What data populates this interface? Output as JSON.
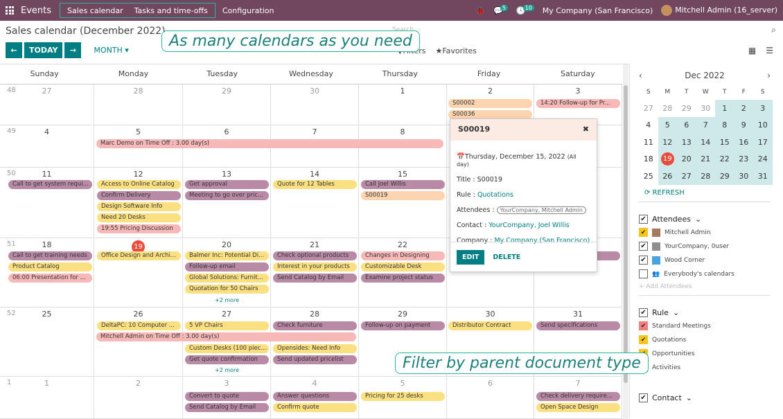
{
  "topbar": {
    "app_name": "Events",
    "nav": [
      "Sales calendar",
      "Tasks and time-offs"
    ],
    "config": "Configuration",
    "msg_count": "5",
    "activity_count": "10",
    "company": "My Company (San Francisco)",
    "user": "Mitchell Admin (16_server)"
  },
  "control": {
    "title": "Sales calendar (December 2022)",
    "search_placeholder": "Search...",
    "today": "TODAY",
    "scale": "MONTH",
    "filters": "Filters",
    "favorites": "Favorites"
  },
  "callouts": {
    "top": "As many calendars as you need",
    "bottom": "Filter by parent document type"
  },
  "calendar": {
    "weekdays": [
      "Sunday",
      "Monday",
      "Tuesday",
      "Wednesday",
      "Thursday",
      "Friday",
      "Saturday"
    ],
    "weeks": [
      {
        "num": "48",
        "days": [
          "27",
          "28",
          "29",
          "30",
          "1",
          "2",
          "3"
        ]
      },
      {
        "num": "49",
        "days": [
          "4",
          "5",
          "6",
          "7",
          "8",
          "9",
          "10"
        ]
      },
      {
        "num": "50",
        "days": [
          "11",
          "12",
          "13",
          "14",
          "15",
          "16",
          "17"
        ]
      },
      {
        "num": "51",
        "days": [
          "18",
          "19",
          "20",
          "21",
          "22",
          "23",
          "24"
        ]
      },
      {
        "num": "52",
        "days": [
          "25",
          "26",
          "27",
          "28",
          "29",
          "30",
          "31"
        ]
      },
      {
        "num": "1",
        "days": [
          "1",
          "2",
          "3",
          "4",
          "5",
          "6",
          "7"
        ]
      }
    ],
    "events": {
      "e0": "S00002",
      "e1": "S00036",
      "e2": "14:20  Follow-up for Pr...",
      "e3": "Marc Demo on Time Off : 3.00 day(s)",
      "e4": "Call to get system requi...",
      "e5": "Access to Online Catalog",
      "e6": "Confirm Delivery",
      "e7": "Design Software Info",
      "e8": "Need 20 Desks",
      "e9": "19:55  Pricing Discussion",
      "e10": "Get approval",
      "e11": "Meeting to go over pric...",
      "e12": "Quote for 12 Tables",
      "e13": "Call Joel Willis",
      "e14": "S00019",
      "e15": "Call to get training needs",
      "e16": "Product Catalog",
      "e17": "06:00  Presentation for ...",
      "e18": "Office Design and Archi...",
      "e19": "Balmer Inc: Potential Di...",
      "e20": "Follow-up email",
      "e21": "Global Solutions: Furnit...",
      "e22": "Quotation for 50 Chairs",
      "e23": "Check optional products",
      "e24": "Interest in your products",
      "e25": "Send Catalog by Email",
      "e26": "Changes in Designing",
      "e27": "Customizable Desk",
      "e28": "Examine project status",
      "e29": "DeltaPC: 10 Computer ...",
      "e30": "5 VP Chairs",
      "e31": "Check furniture",
      "e32": "Follow-up on payment",
      "e33": "Distributor Contract",
      "e34": "Send specifications",
      "e35": "Mitchell Admin on Time Off : 3.00 day(s)",
      "e36": "Custom Desks (100 piec...",
      "e37": "Opensides: Need Info",
      "e38": "Get quote confirmation",
      "e39": "Send updated pricelist",
      "e40": "Convert to quote",
      "e41": "Answer questions",
      "e42": "Pricing for 25 desks",
      "e43": "Check delivery require...",
      "e44": "Send Catalog by Email",
      "e45": "Confirm quote",
      "e46": "Open Space Design",
      "more1": "+2 more",
      "more2": "+2 more"
    }
  },
  "popover": {
    "title": "S00019",
    "date": "Thursday, December 15, 2022",
    "allday": "(All day)",
    "title_label": "Title :",
    "title_value": "S00019",
    "rule_label": "Rule :",
    "rule_value": "Quotations",
    "att_label": "Attendees :",
    "att_value": "YourCompany, Mitchell Admin",
    "contact_label": "Contact :",
    "contact_value": "YourCompany, Joel Willis",
    "company_label": "Company :",
    "company_value": "My Company (San Francisco)",
    "edit": "EDIT",
    "delete": "DELETE"
  },
  "sidebar": {
    "month": "Dec 2022",
    "dow": [
      "S",
      "M",
      "T",
      "W",
      "T",
      "F",
      "S"
    ],
    "refresh": "REFRESH",
    "attendees_label": "Attendees",
    "attendees": [
      "Mitchell Admin",
      "YourCompany, 0user",
      "Wood Corner",
      "Everybody's calendars"
    ],
    "add_attendees": "+ Add Attendees",
    "rule_label": "Rule",
    "rules": [
      "Standard Meetings",
      "Quotations",
      "Opportunities",
      "Activities"
    ],
    "contact_label": "Contact"
  },
  "colors": {
    "brand": "#71465f",
    "accent": "#017e84",
    "callout": "#2bb3a6",
    "today": "#e74c3c"
  }
}
